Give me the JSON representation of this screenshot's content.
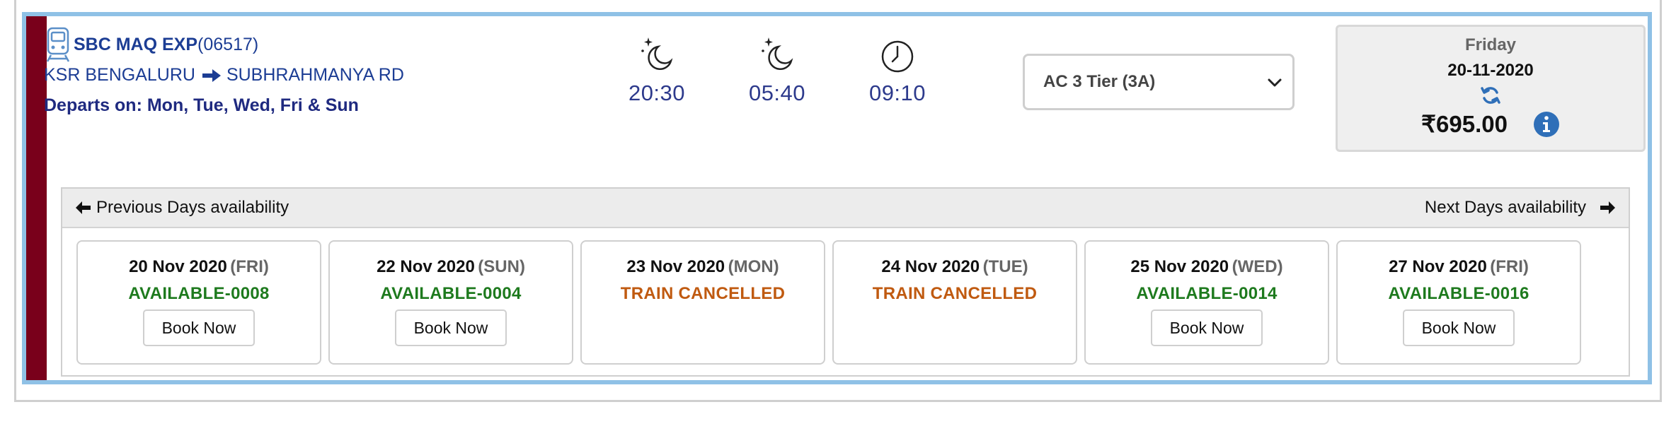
{
  "train": {
    "name": "SBC MAQ EXP",
    "number": "(06517)",
    "from": "KSR BENGALURU",
    "to": "SUBHRAHMANYA RD",
    "departs": "Departs on: Mon, Tue, Wed, Fri & Sun"
  },
  "times": [
    {
      "icon": "night-icon",
      "value": "20:30"
    },
    {
      "icon": "night-icon",
      "value": "05:40"
    },
    {
      "icon": "clock-icon",
      "value": "09:10"
    }
  ],
  "class_select": {
    "selected": "AC 3 Tier (3A)"
  },
  "price_box": {
    "day": "Friday",
    "date": "20-11-2020",
    "price": "₹695.00"
  },
  "availability": {
    "prev_label": "Previous Days availability",
    "next_label": "Next Days availability",
    "days": [
      {
        "date": "20 Nov 2020",
        "dow": "(FRI)",
        "status": "AVAILABLE-0008",
        "status_type": "available",
        "button": "Book Now"
      },
      {
        "date": "22 Nov 2020",
        "dow": "(SUN)",
        "status": "AVAILABLE-0004",
        "status_type": "available",
        "button": "Book Now"
      },
      {
        "date": "23 Nov 2020",
        "dow": "(MON)",
        "status": "TRAIN CANCELLED",
        "status_type": "cancelled",
        "button": ""
      },
      {
        "date": "24 Nov 2020",
        "dow": "(TUE)",
        "status": "TRAIN CANCELLED",
        "status_type": "cancelled",
        "button": ""
      },
      {
        "date": "25 Nov 2020",
        "dow": "(WED)",
        "status": "AVAILABLE-0014",
        "status_type": "available",
        "button": "Book Now"
      },
      {
        "date": "27 Nov 2020",
        "dow": "(FRI)",
        "status": "AVAILABLE-0016",
        "status_type": "available",
        "button": "Book Now"
      }
    ]
  },
  "colors": {
    "accent_bar": "#79001b",
    "card_border": "#8fc1e6",
    "train_text": "#1c3d94",
    "available": "#1e7a1e",
    "cancelled": "#c05a10",
    "info_icon": "#2f6fb8"
  }
}
